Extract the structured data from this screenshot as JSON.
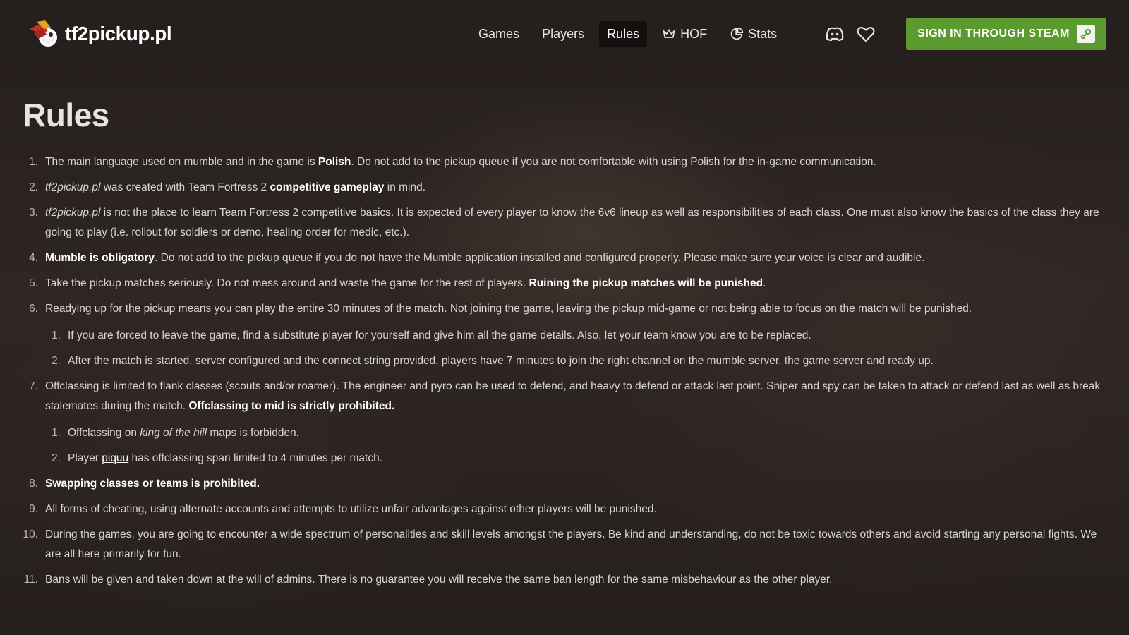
{
  "header": {
    "logo_text": "tf2pickup.pl",
    "nav": [
      {
        "label": "Games",
        "icon": ""
      },
      {
        "label": "Players",
        "icon": ""
      },
      {
        "label": "Rules",
        "icon": "",
        "active": true
      },
      {
        "label": "HOF",
        "icon": "crown-icon"
      },
      {
        "label": "Stats",
        "icon": "pie-chart-icon"
      }
    ],
    "social_icons": [
      "discord-icon",
      "heart-icon"
    ],
    "signin_label": "SIGN IN THROUGH STEAM",
    "signin_color": "#5b9a2f"
  },
  "page": {
    "title": "Rules"
  },
  "rules": {
    "r1": {
      "a": "The main language used on mumble and in the game is ",
      "b": "Polish",
      "c": ". Do not add to the pickup queue if you are not comfortable with using Polish for the in-game communication."
    },
    "r2": {
      "a": "tf2pickup.pl",
      "b": " was created with Team Fortress 2 ",
      "c": "competitive gameplay",
      "d": " in mind."
    },
    "r3": {
      "a": "tf2pickup.pl",
      "b": " is not the place to learn Team Fortress 2 competitive basics. It is expected of every player to know the 6v6 lineup as well as responsibilities of each class. One must also know the basics of the class they are going to play (i.e. rollout for soldiers or demo, healing order for medic, etc.)."
    },
    "r4": {
      "a": "Mumble is obligatory",
      "b": ". Do not add to the pickup queue if you do not have the Mumble application installed and configured properly. Please make sure your voice is clear and audible."
    },
    "r5": {
      "a": "Take the pickup matches seriously. Do not mess around and waste the game for the rest of players. ",
      "b": "Ruining the pickup matches will be punished",
      "c": "."
    },
    "r6": {
      "text": "Readying up for the pickup means you can play the entire 30 minutes of the match. Not joining the game, leaving the pickup mid-game or not being able to focus on the match will be punished.",
      "sub1": "If you are forced to leave the game, find a substitute player for yourself and give him all the game details. Also, let your team know you are to be replaced.",
      "sub2": "After the match is started, server configured and the connect string provided, players have 7 minutes to join the right channel on the mumble server, the game server and ready up."
    },
    "r7": {
      "a": "Offclassing is limited to flank classes (scouts and/or roamer). The engineer and pyro can be used to defend, and heavy to defend or attack last point. Sniper and spy can be taken to attack or defend last as well as break stalemates during the match. ",
      "b": "Offclassing to mid is strictly prohibited.",
      "sub1": {
        "a": "Offclassing on ",
        "b": "king of the hill",
        "c": " maps is forbidden."
      },
      "sub2": {
        "a": "Player ",
        "b": "piquu",
        "c": " has offclassing span limited to 4 minutes per match."
      }
    },
    "r8": {
      "a": "Swapping classes or teams is prohibited."
    },
    "r9": {
      "a": "All forms of cheating, using alternate accounts and attempts to utilize unfair advantages against other players will be punished."
    },
    "r10": {
      "a": "During the games, you are going to encounter a wide spectrum of personalities and skill levels amongst the players. Be kind and understanding, do not be toxic towards others and avoid starting any personal fights. We are all here primarily for fun."
    },
    "r11": {
      "a": "Bans will be given and taken down at the will of admins. There is no guarantee you will receive the same ban length for the same misbehaviour as the other player."
    }
  },
  "numbers": {
    "n1": "1.",
    "n2": "2.",
    "n3": "3.",
    "n4": "4.",
    "n5": "5.",
    "n6": "6.",
    "n7": "7.",
    "n8": "8.",
    "n9": "9.",
    "n10": "10.",
    "n11": "11.",
    "s1": "1.",
    "s2": "2."
  }
}
